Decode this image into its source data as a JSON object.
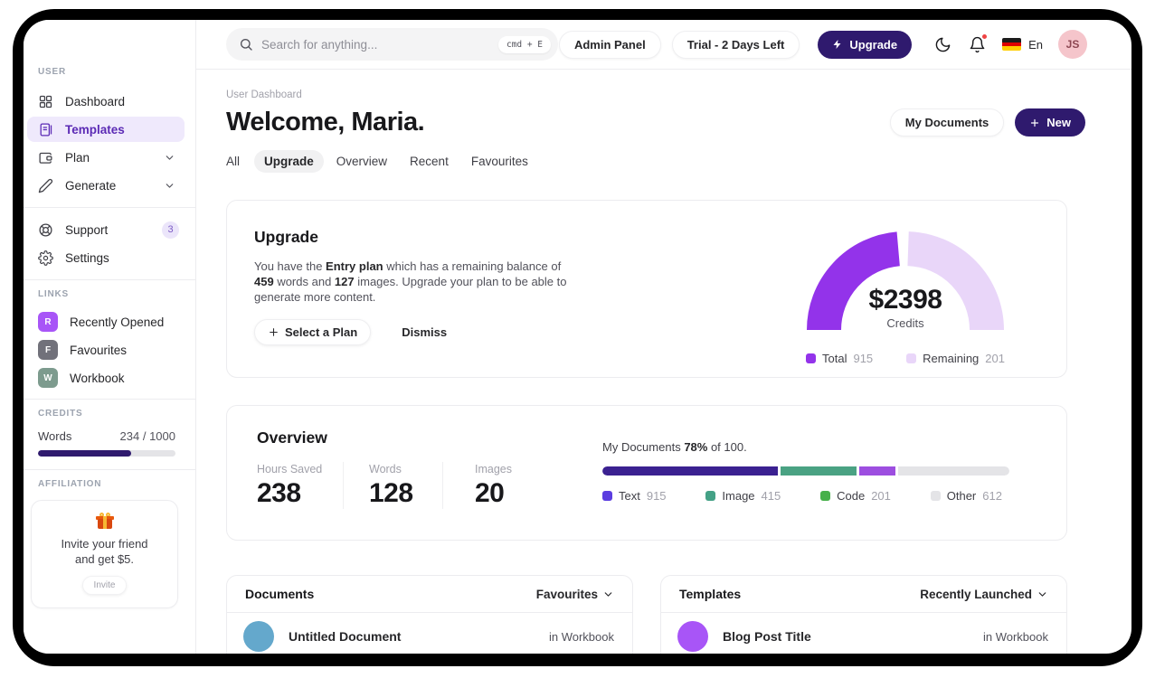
{
  "topbar": {
    "search": {
      "placeholder": "Search for anything...",
      "shortcut": "cmd + E"
    },
    "admin_panel": "Admin Panel",
    "trial": "Trial - 2 Days Left",
    "upgrade": "Upgrade",
    "language": "En",
    "avatar": "JS"
  },
  "sidebar": {
    "sections": {
      "user": "USER",
      "links": "LINKS",
      "credits": "CREDITS",
      "affiliation": "AFFILIATION"
    },
    "nav": [
      {
        "label": "Dashboard",
        "icon": "grid-icon"
      },
      {
        "label": "Templates",
        "icon": "templates-icon",
        "active": true
      },
      {
        "label": "Plan",
        "icon": "wallet-icon",
        "expandable": true
      },
      {
        "label": "Generate",
        "icon": "pencil-icon",
        "expandable": true
      }
    ],
    "secondary": [
      {
        "label": "Support",
        "icon": "lifebuoy-icon",
        "badge": "3"
      },
      {
        "label": "Settings",
        "icon": "gear-icon"
      }
    ],
    "links": [
      {
        "label": "Recently Opened",
        "letter": "R",
        "color": "#a855f7"
      },
      {
        "label": "Favourites",
        "letter": "F",
        "color": "#71717a"
      },
      {
        "label": "Workbook",
        "letter": "W",
        "color": "#7d9b8e"
      }
    ],
    "credits": {
      "label": "Words",
      "value": "234 / 1000",
      "percent": 68,
      "fill_color": "#2f1a6e"
    },
    "affiliation": {
      "icon": "gift-icon",
      "line1": "Invite your friend",
      "line2": "and get $5.",
      "button": "Invite"
    }
  },
  "header": {
    "breadcrumb": "User Dashboard",
    "title": "Welcome, Maria.",
    "tabs": [
      {
        "label": "All"
      },
      {
        "label": "Upgrade",
        "active": true
      },
      {
        "label": "Overview"
      },
      {
        "label": "Recent"
      },
      {
        "label": "Favourites"
      }
    ],
    "my_documents": "My Documents",
    "new_button": "New"
  },
  "upgrade_card": {
    "title": "Upgrade",
    "body": [
      {
        "text": "You have the "
      },
      {
        "text": "Entry plan",
        "bold": true
      },
      {
        "text": " which has a remaining balance of "
      },
      {
        "text": "459",
        "bold": true
      },
      {
        "text": " words and "
      },
      {
        "text": "127",
        "bold": true
      },
      {
        "text": " images. Upgrade your plan to be able to generate more content."
      }
    ],
    "select_plan": "Select a Plan",
    "dismiss": "Dismiss",
    "gauge": {
      "type": "half-donut",
      "value": "$2398",
      "caption": "Credits",
      "legend": [
        {
          "label": "Total",
          "value": "915",
          "color": "#9333ea"
        },
        {
          "label": "Remaining",
          "value": "201",
          "color": "#e9d6f9"
        }
      ]
    }
  },
  "overview_card": {
    "title": "Overview",
    "stats": [
      {
        "label": "Hours Saved",
        "value": "238"
      },
      {
        "label": "Words",
        "value": "128"
      },
      {
        "label": "Images",
        "value": "20"
      }
    ],
    "documents_progress": {
      "label_parts": [
        "My Documents ",
        "78%",
        " of 100."
      ],
      "segments": [
        {
          "name": "Text",
          "value": "915",
          "percent": 44,
          "bar_color": "#3b2191",
          "legend_color": "#5b3de0"
        },
        {
          "name": "Image",
          "value": "415",
          "percent": 19,
          "bar_color": "#4aa283",
          "legend_color": "#44a186"
        },
        {
          "name": "Code",
          "value": "201",
          "percent": 9,
          "bar_color": "#9d4ee0",
          "legend_color": "#47b04b"
        },
        {
          "name": "Other",
          "value": "612",
          "percent": 28,
          "bar_color": "#e4e4e7",
          "legend_color": "#e4e4e7"
        }
      ]
    }
  },
  "documents_card": {
    "title": "Documents",
    "filter": "Favourites",
    "rows": [
      {
        "title": "Untitled Document",
        "location": "in Workbook",
        "avatar_color": "#64a8cc"
      }
    ]
  },
  "templates_card": {
    "title": "Templates",
    "filter": "Recently Launched",
    "rows": [
      {
        "title": "Blog Post Title",
        "location": "in Workbook",
        "avatar_color": "#a855f7"
      }
    ]
  }
}
